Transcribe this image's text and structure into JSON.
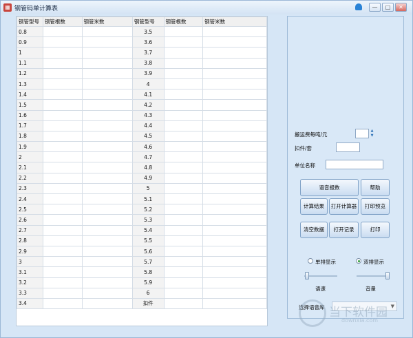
{
  "window": {
    "title": "钢管码单计算表",
    "controls": [
      "—",
      "□",
      "✕"
    ]
  },
  "table": {
    "headers": [
      "钢管型号",
      "钢管根数",
      "钢管米数",
      "钢管型号",
      "钢管根数",
      "钢管米数"
    ],
    "left_types": [
      "0.8",
      "0.9",
      "1",
      "1.1",
      "1.2",
      "1.3",
      "1.4",
      "1.5",
      "1.6",
      "1.7",
      "1.8",
      "1.9",
      "2",
      "2.1",
      "2.2",
      "2.3",
      "2.4",
      "2.5",
      "2.6",
      "2.7",
      "2.8",
      "2.9",
      "3",
      "3.1",
      "3.2",
      "3.3",
      "3.4"
    ],
    "right_types": [
      "3.5",
      "3.6",
      "3.7",
      "3.8",
      "3.9",
      "4",
      "4.1",
      "4.2",
      "4.3",
      "4.4",
      "4.5",
      "4.6",
      "4.7",
      "4.8",
      "4.9",
      "5",
      "5.1",
      "5.2",
      "5.3",
      "5.4",
      "5.5",
      "5.6",
      "5.7",
      "5.8",
      "5.9",
      "6",
      "扣件"
    ]
  },
  "panel": {
    "freight_label": "搬运费每吨/元",
    "freight_value": "",
    "fastener_label": "扣件/套",
    "fastener_value": "",
    "company_label": "单位名称",
    "company_value": "",
    "buttons": {
      "voice": "语音报数",
      "help": "帮助",
      "calc_result": "计算结果",
      "open_calculator": "打开计算器",
      "print_preview": "打印预览",
      "clear_data": "清空数据",
      "open_record": "打开记录",
      "print": "打印"
    },
    "single_display": "单排显示",
    "double_display": "双排显示",
    "speed_label": "语速",
    "volume_label": "音量",
    "voice_lib_label": "选择语音库",
    "voice_lib_value": ""
  },
  "watermark": {
    "title": "当下软件园",
    "site": "downxia.com"
  }
}
